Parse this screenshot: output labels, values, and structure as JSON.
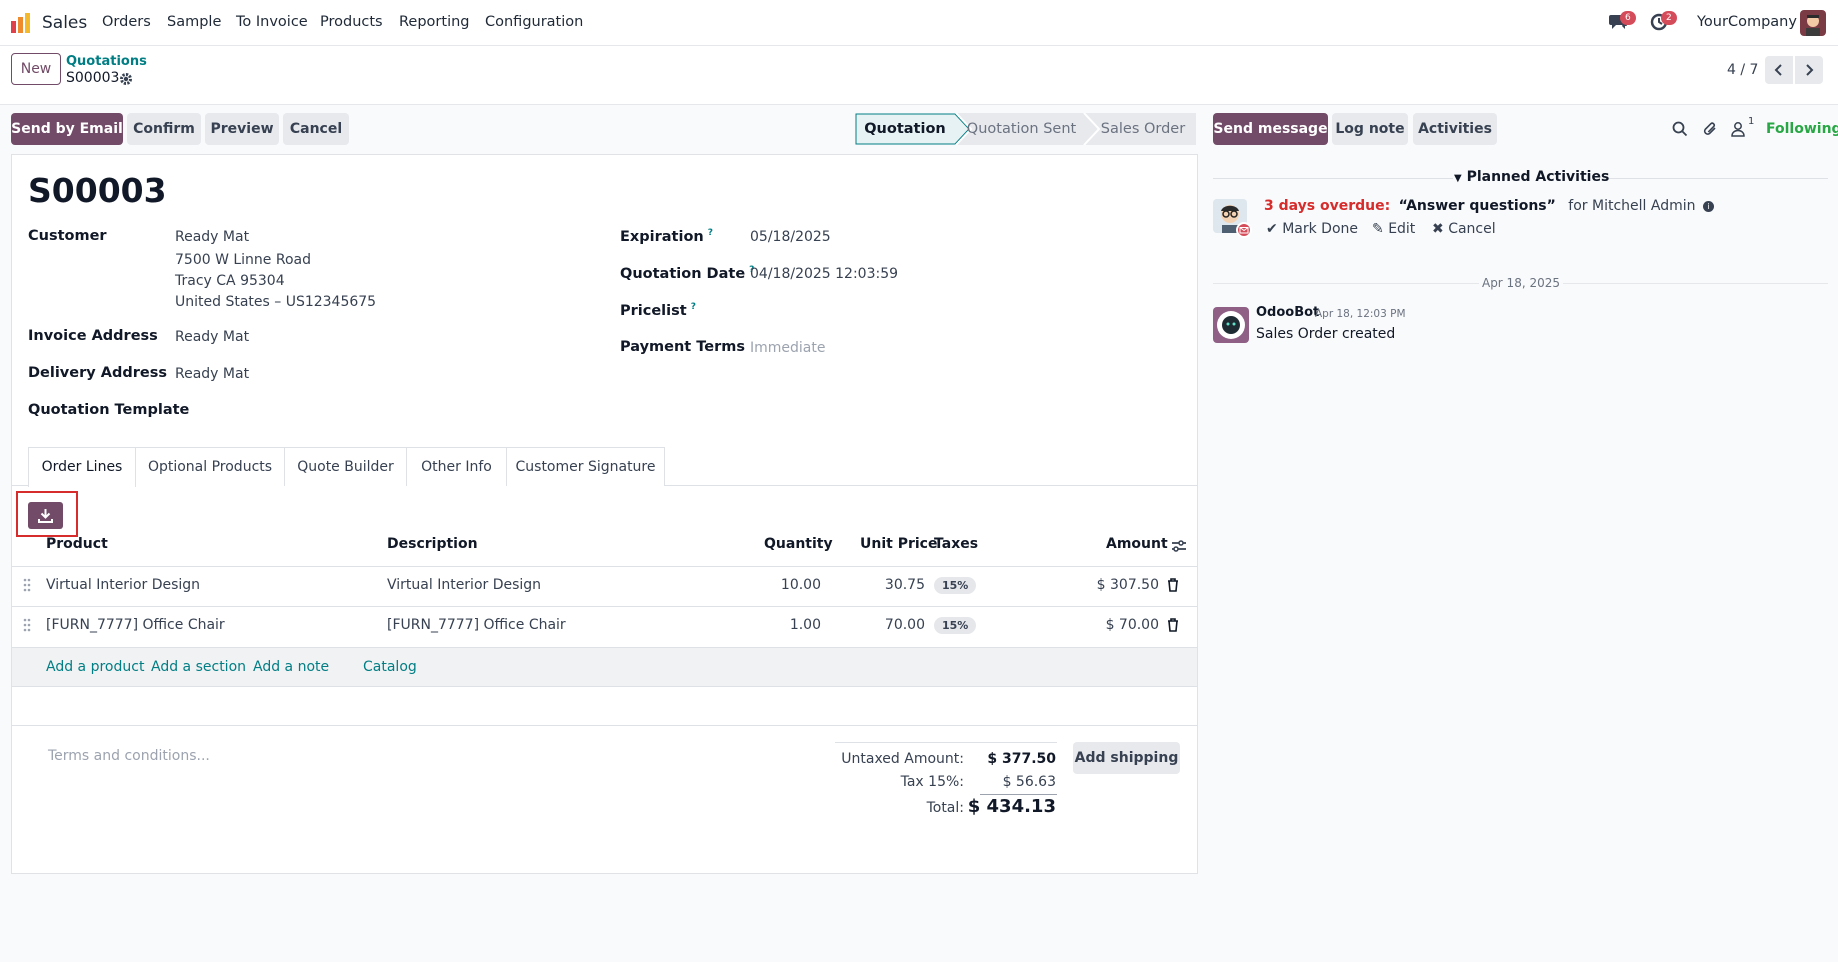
{
  "navbar": {
    "app_name": "Sales",
    "menu": [
      "Orders",
      "Sample",
      "To Invoice",
      "Products",
      "Reporting",
      "Configuration"
    ],
    "messages_count": "6",
    "activities_count": "2",
    "company": "YourCompany"
  },
  "control": {
    "new_label": "New",
    "breadcrumb_parent": "Quotations",
    "breadcrumb_current": "S00003",
    "pager": "4 / 7"
  },
  "actions": {
    "send_email": "Send by Email",
    "confirm": "Confirm",
    "preview": "Preview",
    "cancel": "Cancel"
  },
  "statusbar": [
    "Quotation",
    "Quotation Sent",
    "Sales Order"
  ],
  "form": {
    "title": "S00003",
    "customer_label": "Customer",
    "customer_name": "Ready Mat",
    "customer_street": "7500 W Linne Road",
    "customer_city": "Tracy CA 95304",
    "customer_country": "United States – US12345675",
    "invoice_address_label": "Invoice Address",
    "invoice_address": "Ready Mat",
    "delivery_address_label": "Delivery Address",
    "delivery_address": "Ready Mat",
    "template_label": "Quotation Template",
    "expiration_label": "Expiration",
    "expiration": "05/18/2025",
    "quotation_date_label": "Quotation Date",
    "quotation_date": "04/18/2025 12:03:59",
    "pricelist_label": "Pricelist",
    "payment_terms_label": "Payment Terms",
    "payment_terms": "Immediate"
  },
  "tabs": [
    "Order Lines",
    "Optional Products",
    "Quote Builder",
    "Other Info",
    "Customer Signature"
  ],
  "table": {
    "headers": {
      "product": "Product",
      "description": "Description",
      "quantity": "Quantity",
      "unit_price": "Unit Price",
      "taxes": "Taxes",
      "amount": "Amount"
    },
    "rows": [
      {
        "product": "Virtual Interior Design",
        "description": "Virtual Interior Design",
        "quantity": "10.00",
        "unit_price": "30.75",
        "tax": "15%",
        "amount": "$ 307.50"
      },
      {
        "product": "[FURN_7777] Office Chair",
        "description": "[FURN_7777] Office Chair",
        "quantity": "1.00",
        "unit_price": "70.00",
        "tax": "15%",
        "amount": "$ 70.00"
      }
    ],
    "add_product": "Add a product",
    "add_section": "Add a section",
    "add_note": "Add a note",
    "catalog": "Catalog"
  },
  "totals": {
    "terms_placeholder": "Terms and conditions...",
    "untaxed_label": "Untaxed Amount:",
    "untaxed": "$ 377.50",
    "tax_label": "Tax 15%:",
    "tax": "$ 56.63",
    "total_label": "Total:",
    "total": "$ 434.13",
    "add_shipping": "Add shipping"
  },
  "chatter": {
    "send_message": "Send message",
    "log_note": "Log note",
    "activities": "Activities",
    "followers_count": "1",
    "following": "Following",
    "planned_title": "Planned Activities",
    "overdue": "3 days overdue:",
    "activity_name": "“Answer questions”",
    "activity_for": "for Mitchell Admin",
    "mark_done": "Mark Done",
    "edit": "Edit",
    "cancel": "Cancel",
    "date_separator": "Apr 18, 2025",
    "author": "OdooBot",
    "msg_time": "Apr 18, 12:03 PM",
    "msg_body": "Sales Order created"
  }
}
